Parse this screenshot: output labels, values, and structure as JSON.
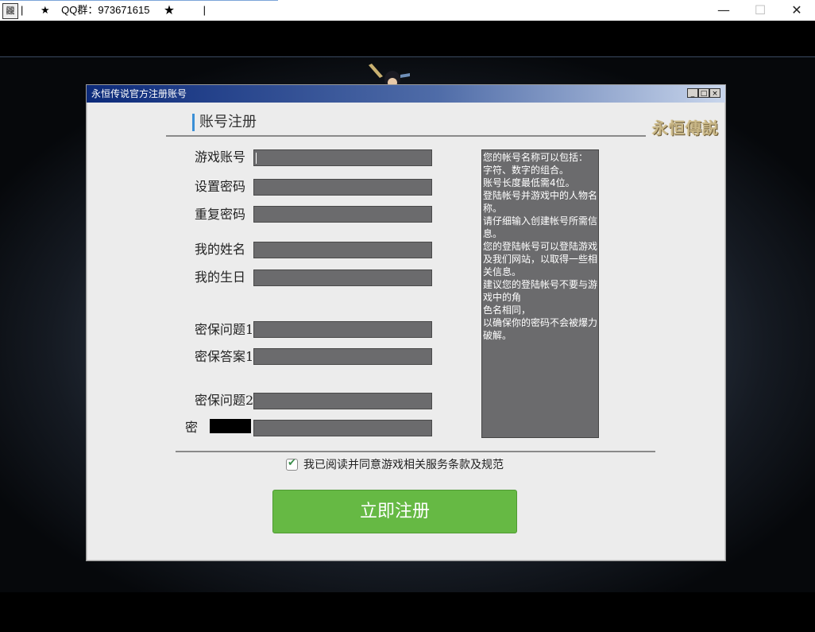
{
  "window": {
    "icon_glyph": "龖",
    "title": "|      ★    QQ群：973671615     ★          |",
    "minimize": "—",
    "maximize": "☐",
    "close": "✕"
  },
  "dialog": {
    "title": "永恒传说官方注册账号",
    "ctrl_min": "_",
    "ctrl_max": "□",
    "ctrl_close": "×",
    "section_title": "账号注册",
    "logo_text": "永恒傳説"
  },
  "form": {
    "fields": [
      {
        "label": "游戏账号"
      },
      {
        "label": "设置密码"
      },
      {
        "label": "重复密码"
      },
      {
        "label": "我的姓名"
      },
      {
        "label": "我的生日"
      },
      {
        "label": "密保问题1"
      },
      {
        "label": "密保答案1"
      },
      {
        "label": "密保问题2"
      },
      {
        "label": "密"
      }
    ]
  },
  "info": {
    "lines": [
      "您的帐号名称可以包括：",
      "字符、数字的组合。",
      "账号长度最低需4位。",
      "登陆帐号并游戏中的人物名",
      "称。",
      "请仔细输入创建帐号所需信",
      "息。",
      "您的登陆帐号可以登陆游戏",
      "及我们网站，以取得一些相",
      "关信息。",
      "建议您的登陆帐号不要与游",
      "戏中的角",
      "色名相同，",
      "以确保你的密码不会被爆力",
      "破解。"
    ]
  },
  "agree": {
    "checked": true,
    "check_glyph": "✔",
    "text": "我已阅读并同意游戏相关服务条款及规范"
  },
  "submit": {
    "label": "立即注册",
    "color": "#66b944"
  }
}
